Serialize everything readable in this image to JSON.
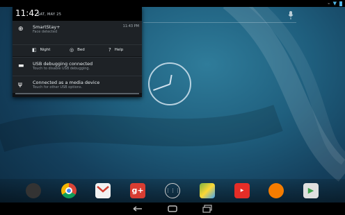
{
  "status_bar": {
    "icons": [
      "usb-icon",
      "wifi-icon",
      "battery-icon"
    ]
  },
  "search": {
    "mic_icon": "mic-icon"
  },
  "notification_shade": {
    "time": "11:42",
    "date": "SAT, MAY 25",
    "notifications": [
      {
        "icon": "crosshair-icon",
        "title": "SmartStay+",
        "subtitle": "Face detected",
        "time": "11:43 PM"
      },
      {
        "icon": "android-icon",
        "title": "USB debugging connected",
        "subtitle": "Touch to disable USB debugging."
      },
      {
        "icon": "usb-icon",
        "title": "Connected as a media device",
        "subtitle": "Touch for other USB options."
      }
    ],
    "actions": [
      {
        "icon": "night-icon",
        "label": "Night"
      },
      {
        "icon": "bed-icon",
        "label": "Bed"
      },
      {
        "icon": "help-icon",
        "label": "Help"
      }
    ]
  },
  "dock": {
    "apps": [
      "app-icon",
      "chrome-icon",
      "gmail-icon",
      "google-plus-icon",
      "apps-drawer-icon",
      "maps-icon",
      "youtube-icon",
      "play-music-icon",
      "play-store-icon"
    ]
  },
  "navigation": {
    "buttons": [
      "back-button",
      "home-button",
      "recents-button"
    ]
  },
  "colors": {
    "shade_bg": "#1e2226",
    "header_bg": "#000000",
    "wallpaper": "#1f5f7e"
  }
}
